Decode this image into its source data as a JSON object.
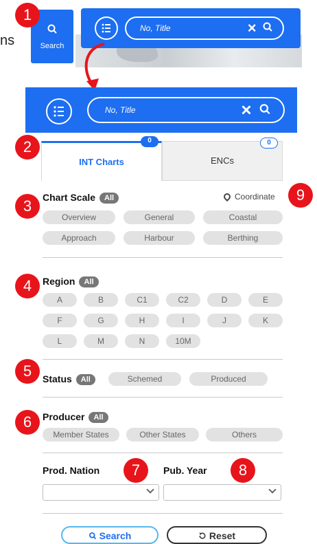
{
  "callouts": [
    "1",
    "2",
    "3",
    "4",
    "5",
    "6",
    "7",
    "8",
    "9"
  ],
  "preview": {
    "fragment_text": "ns",
    "side_button": {
      "icon": "search-icon",
      "label": "Search"
    },
    "search_placeholder": "No, Title",
    "clear_icon": "×",
    "search_icon": "⌕"
  },
  "searchbar": {
    "placeholder": "No, Title",
    "clear_icon": "×",
    "search_icon": "⌕",
    "list_icon": "list-icon"
  },
  "tabs": [
    {
      "label": "INT Charts",
      "count": "0",
      "active": true
    },
    {
      "label": "ENCs",
      "count": "0",
      "active": false
    }
  ],
  "chart_scale": {
    "title": "Chart Scale",
    "all": "All",
    "coordinate": "Coordinate",
    "options": [
      "Overview",
      "General",
      "Coastal",
      "Approach",
      "Harbour",
      "Berthing"
    ]
  },
  "region": {
    "title": "Region",
    "all": "All",
    "options": [
      "A",
      "B",
      "C1",
      "C2",
      "D",
      "E",
      "F",
      "G",
      "H",
      "I",
      "J",
      "K",
      "L",
      "M",
      "N",
      "10M"
    ]
  },
  "status": {
    "title": "Status",
    "all": "All",
    "options": [
      "Schemed",
      "Produced"
    ]
  },
  "producer": {
    "title": "Producer",
    "all": "All",
    "options": [
      "Member States",
      "Other States",
      "Others"
    ]
  },
  "prod_nation": {
    "label": "Prod. Nation",
    "value": ""
  },
  "pub_year": {
    "label": "Pub. Year",
    "value": ""
  },
  "actions": {
    "search": "Search",
    "reset": "Reset"
  },
  "colors": {
    "accent": "#1d6ef0",
    "badge": "#e8141b",
    "chip": "#e2e2e2"
  }
}
